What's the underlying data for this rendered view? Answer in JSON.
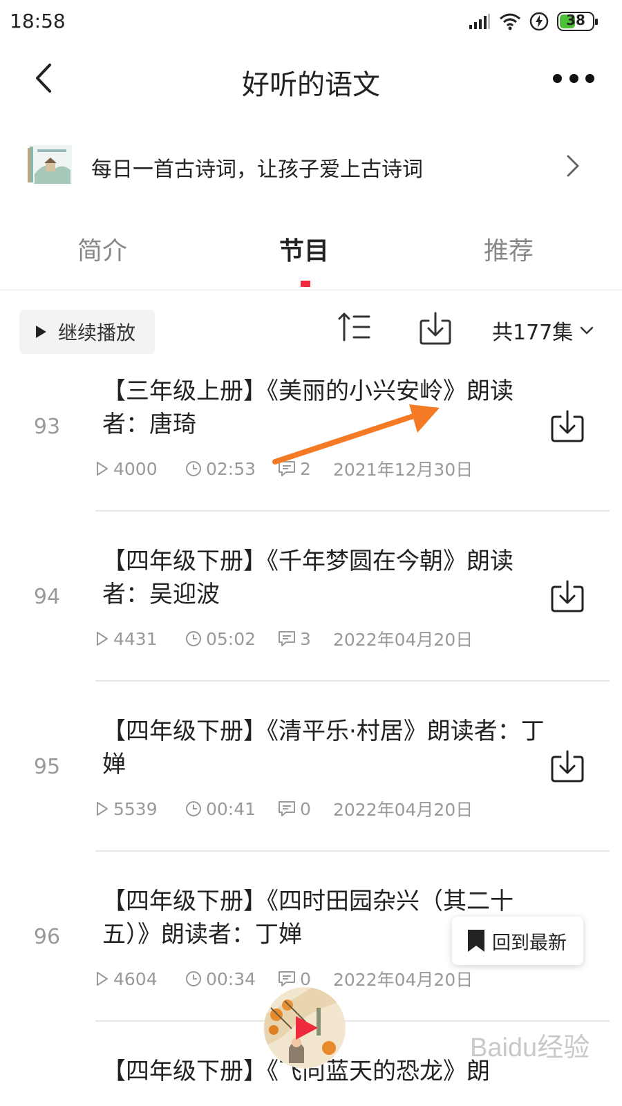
{
  "status_bar": {
    "time": "18:58",
    "battery": "38"
  },
  "nav": {
    "title": "好听的语文"
  },
  "album": {
    "description": "每日一首古诗词，让孩子爱上古诗词"
  },
  "tabs": [
    {
      "label": "简介",
      "active": false
    },
    {
      "label": "节目",
      "active": true
    },
    {
      "label": "推荐",
      "active": false
    }
  ],
  "toolbar": {
    "continue_label": "继续播放",
    "episode_count": "共177集"
  },
  "episodes": [
    {
      "index": "93",
      "title": "【三年级上册】《美丽的小兴安岭》朗读者：唐琦",
      "plays": "4000",
      "duration": "02:53",
      "comments": "2",
      "date": "2021年12月30日"
    },
    {
      "index": "94",
      "title": "【四年级下册】《千年梦圆在今朝》朗读者：吴迎波",
      "plays": "4431",
      "duration": "05:02",
      "comments": "3",
      "date": "2022年04月20日"
    },
    {
      "index": "95",
      "title": "【四年级下册】《清平乐·村居》朗读者：丁婵",
      "plays": "5539",
      "duration": "00:41",
      "comments": "0",
      "date": "2022年04月20日"
    },
    {
      "index": "96",
      "title": "【四年级下册】《四时田园杂兴（其二十五）》朗读者：丁婵",
      "plays": "4604",
      "duration": "00:34",
      "comments": "0",
      "date": "2022年04月20日"
    },
    {
      "index": "",
      "title": "【四年级下册】《飞向蓝天的恐龙》朗",
      "plays": "",
      "duration": "",
      "comments": "",
      "date": ""
    }
  ],
  "floating": {
    "latest_label": "回到最新"
  },
  "watermark": {
    "text": "Baidu经验"
  },
  "colors": {
    "accent": "#ee2a3c",
    "annotation": "#f47a25",
    "battery": "#4cbf38"
  }
}
